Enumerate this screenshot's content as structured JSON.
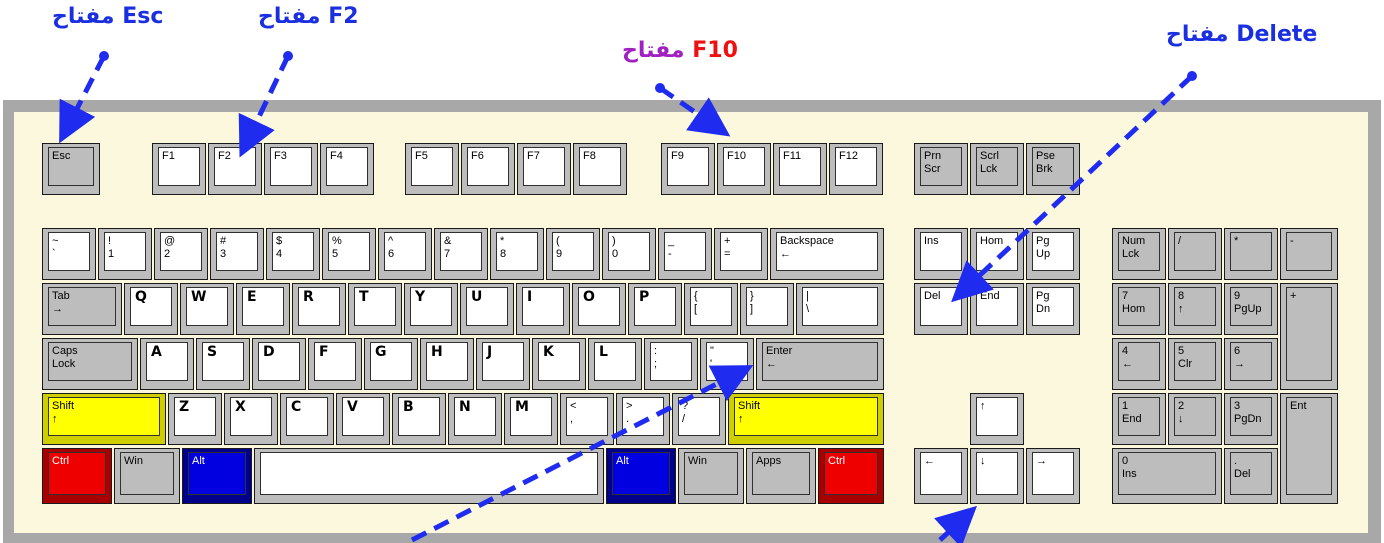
{
  "annotations": {
    "esc": "مفتاح Esc",
    "f2": "مفتاح F2",
    "f10_word": "مفتاح",
    "f10_key": "F10",
    "delete": "مفتاح Delete"
  },
  "colors": {
    "annotation_blue": "#1a2fe0",
    "annotation_purple": "#a020c0",
    "annotation_red": "#ee1111",
    "arrow_blue": "#1f2cf0",
    "keyboard_body": "#fbf8de",
    "keyboard_frame": "#a8a8a8",
    "key_yellow": "#ffff00",
    "key_red": "#ee0000",
    "key_blue": "#0000e0"
  },
  "keys": {
    "esc": "Esc",
    "f1": "F1",
    "f2": "F2",
    "f3": "F3",
    "f4": "F4",
    "f5": "F5",
    "f6": "F6",
    "f7": "F7",
    "f8": "F8",
    "f9": "F9",
    "f10": "F10",
    "f11": "F11",
    "f12": "F12",
    "prnscr_1": "Prn",
    "prnscr_2": "Scr",
    "scrllck_1": "Scrl",
    "scrllck_2": "Lck",
    "psebrk_1": "Pse",
    "psebrk_2": "Brk",
    "tilde_1": "~",
    "tilde_2": "`",
    "n1_1": "!",
    "n1_2": "1",
    "n2_1": "@",
    "n2_2": "2",
    "n3_1": "#",
    "n3_2": "3",
    "n4_1": "$",
    "n4_2": "4",
    "n5_1": "%",
    "n5_2": "5",
    "n6_1": "^",
    "n6_2": "6",
    "n7_1": "&",
    "n7_2": "7",
    "n8_1": "*",
    "n8_2": "8",
    "n9_1": "(",
    "n9_2": "9",
    "n0_1": ")",
    "n0_2": "0",
    "minus_1": "_",
    "minus_2": "-",
    "equal_1": "+",
    "equal_2": "=",
    "backspace": "Backspace",
    "tab": "Tab",
    "q": "Q",
    "w": "W",
    "e": "E",
    "r": "R",
    "t": "T",
    "y": "Y",
    "u": "U",
    "i": "I",
    "o": "O",
    "p": "P",
    "lbracket_1": "{",
    "lbracket_2": "[",
    "rbracket_1": "}",
    "rbracket_2": "]",
    "bslash_1": "|",
    "bslash_2": "\\",
    "caps_1": "Caps",
    "caps_2": "Lock",
    "a": "A",
    "s": "S",
    "d": "D",
    "f": "F",
    "g": "G",
    "h": "H",
    "j": "J",
    "k": "K",
    "l": "L",
    "semicolon_1": ":",
    "semicolon_2": ";",
    "quote_1": "\"",
    "quote_2": "'",
    "enter": "Enter",
    "shift": "Shift",
    "z": "Z",
    "x": "X",
    "c": "C",
    "v": "V",
    "b": "B",
    "n": "N",
    "m": "M",
    "comma_1": "<",
    "comma_2": ",",
    "period_1": ">",
    "period_2": ".",
    "slash_1": "?",
    "slash_2": "/",
    "ctrl": "Ctrl",
    "win": "Win",
    "alt": "Alt",
    "apps": "Apps",
    "ins": "Ins",
    "home": "Hom",
    "pgup_1": "Pg",
    "pgup_2": "Up",
    "del": "Del",
    "end": "End",
    "pgdn_1": "Pg",
    "pgdn_2": "Dn",
    "arrow_up": "↑",
    "arrow_left": "←",
    "arrow_down": "↓",
    "arrow_right": "→",
    "numlock_1": "Num",
    "numlock_2": "Lck",
    "np_slash": "/",
    "np_star": "*",
    "np_minus": "-",
    "np_plus": "+",
    "np7_1": "7",
    "np7_2": "Hom",
    "np8_1": "8",
    "np8_2": "↑",
    "np9_1": "9",
    "np9_2": "PgUp",
    "np4_1": "4",
    "np4_2": "←",
    "np5_1": "5",
    "np5_2": "Clr",
    "np6_1": "6",
    "np6_2": "→",
    "np1_1": "1",
    "np1_2": "End",
    "np2_1": "2",
    "np2_2": "↓",
    "np3_1": "3",
    "np3_2": "PgDn",
    "np0_1": "0",
    "np0_2": "Ins",
    "npdot_1": ".",
    "npdot_2": "Del",
    "np_enter": "Ent"
  }
}
